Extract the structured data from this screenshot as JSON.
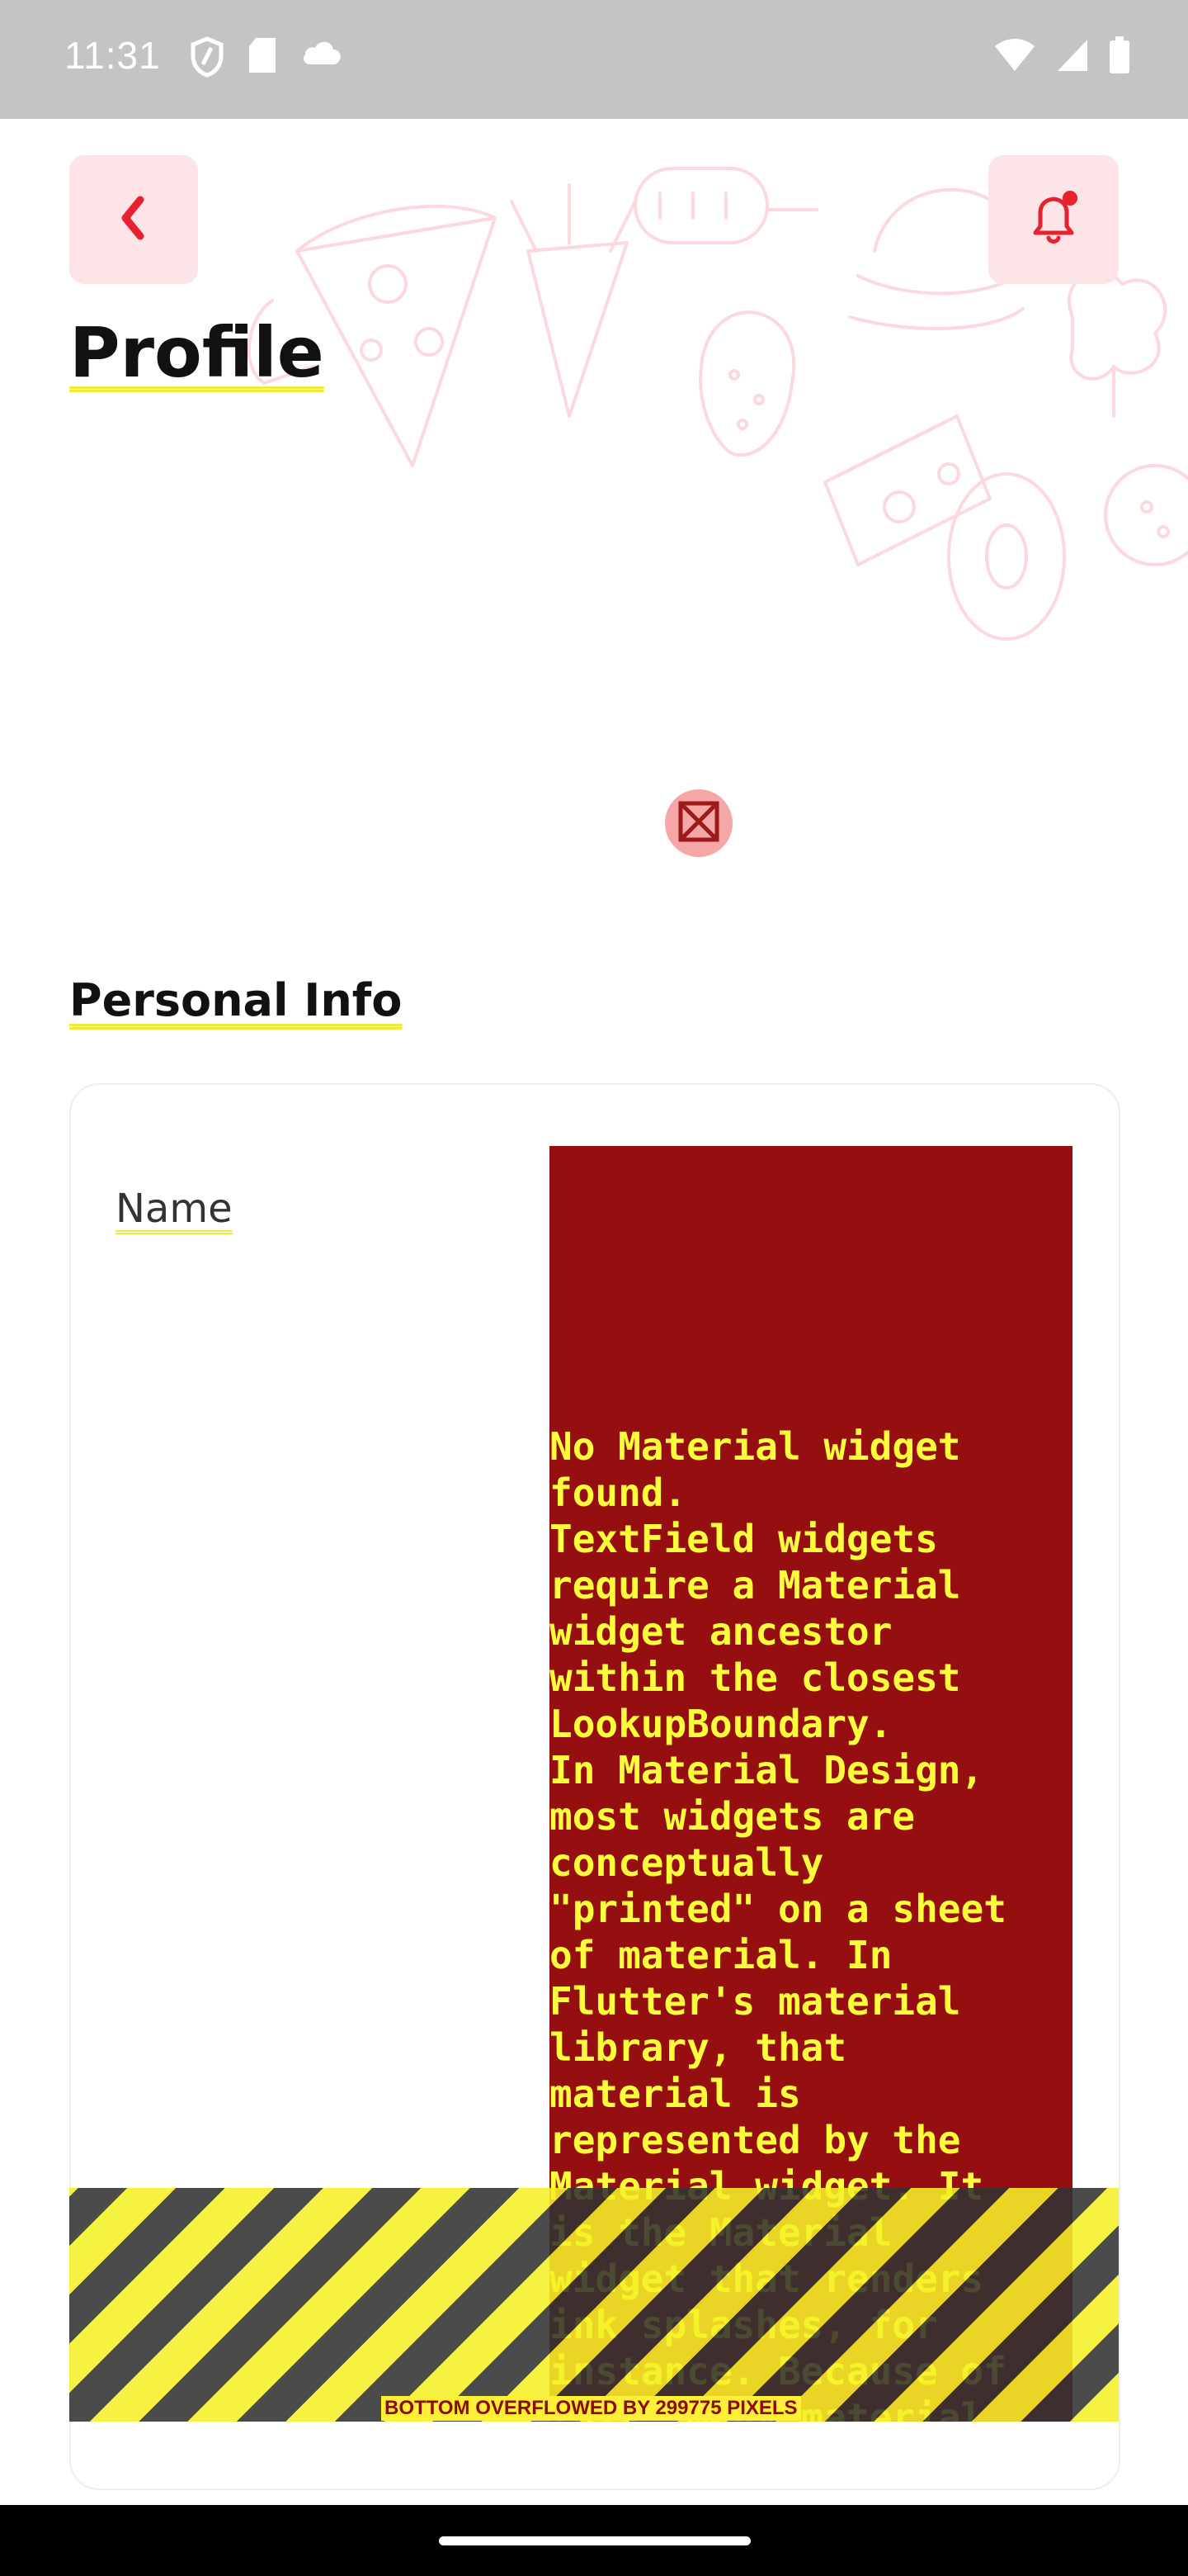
{
  "status_bar": {
    "time": "11:31",
    "left_icons": [
      "shield-icon",
      "sd-card-icon",
      "cloud-icon"
    ],
    "right_icons": [
      "wifi-icon",
      "signal-icon",
      "battery-icon"
    ]
  },
  "header": {
    "back_icon": "chevron-left-icon",
    "notification_icon": "bell-icon",
    "notification_dot": true,
    "title": "Profile"
  },
  "profile": {
    "avatar": "broken-image-icon"
  },
  "personal_info": {
    "section_title": "Personal Info",
    "fields": [
      {
        "label": "Name"
      }
    ]
  },
  "error": {
    "message": "No Material widget\nfound.\nTextField widgets\nrequire a Material\nwidget ancestor\nwithin the closest\nLookupBoundary.\nIn Material Design,\nmost widgets are\nconceptually\n\"printed\" on a sheet\nof material. In\nFlutter's material\nlibrary, that\nmaterial is\nrepresented by the\nMaterial widget. It\nis the Material\nwidget that renders\nink splashes, for\ninstance. Because of\nthis, many material",
    "overflow_label": "BOTTOM OVERFLOWED BY 299775 PIXELS"
  },
  "colors": {
    "accent": "#e8212e",
    "button_bg": "#fde4e6",
    "error_bg": "#960f10",
    "error_text": "#fdfd3c",
    "stripe_yellow": "#f5f028",
    "stripe_dark": "#323232"
  }
}
